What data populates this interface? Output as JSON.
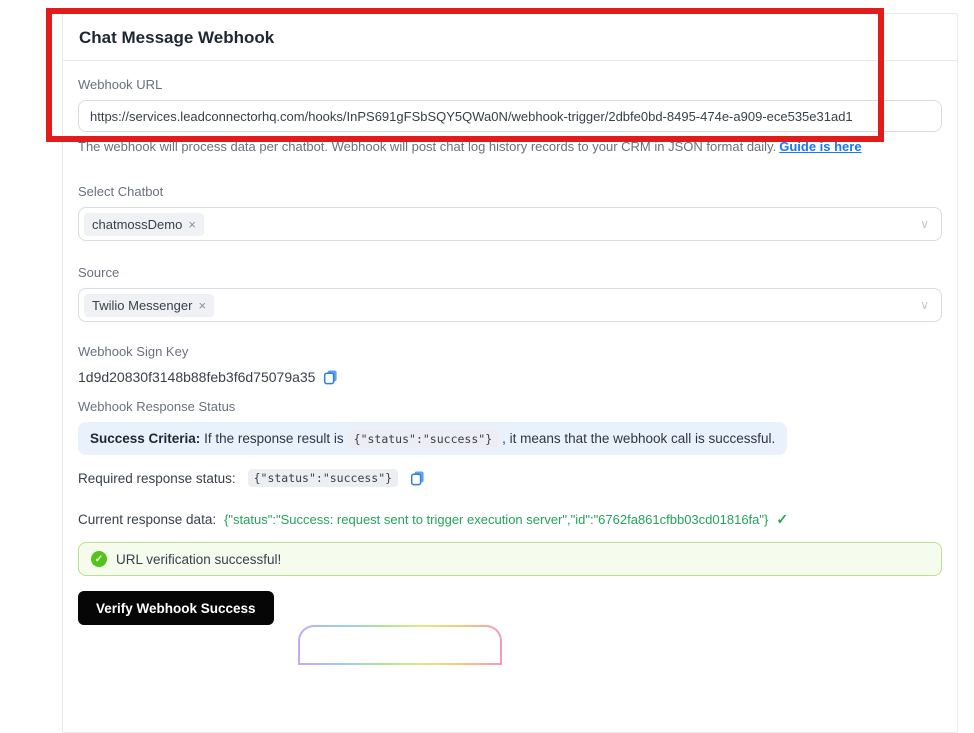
{
  "card": {
    "title": "Chat Message Webhook"
  },
  "webhook_url": {
    "label": "Webhook URL",
    "value": "https://services.leadconnectorhq.com/hooks/InPS691gFSbSQY5QWa0N/webhook-trigger/2dbfe0bd-8495-474e-a909-ece535e31ad1",
    "help_text": "The webhook will process data per chatbot. Webhook will post chat log history records to your CRM in JSON format daily.",
    "help_link": "Guide is here"
  },
  "select_chatbot": {
    "label": "Select Chatbot",
    "selected_tag": "chatmossDemo"
  },
  "source": {
    "label": "Source",
    "selected_tag": "Twilio Messenger"
  },
  "sign_key": {
    "label": "Webhook Sign Key",
    "value": "1d9d20830f3148b88feb3f6d75079a35"
  },
  "response_status": {
    "label": "Webhook Response Status",
    "criteria_bold": "Success Criteria:",
    "criteria_pre": " If the response result is",
    "criteria_code": "{\"status\":\"success\"}",
    "criteria_post": ", it means that the webhook call is successful."
  },
  "required_status": {
    "label": "Required response status:",
    "code": "{\"status\":\"success\"}"
  },
  "current_response": {
    "label": "Current response data:",
    "value": "{\"status\":\"Success: request sent to trigger execution server\",\"id\":\"6762fa861cfbb03cd01816fa\"}"
  },
  "alert": {
    "message": "URL verification successful!"
  },
  "verify_button": {
    "label": "Verify Webhook Success"
  },
  "icons": {
    "chevron_down": "∨",
    "remove": "×",
    "check": "✓"
  },
  "colors": {
    "annotation_red": "#e21b1b",
    "link_blue": "#1677ff",
    "copy_blue": "#2f7fe8",
    "success_green": "#23a45a",
    "alert_icon_green": "#52c41a",
    "alert_bg": "#f5fbed",
    "alert_border": "#b9e18e",
    "info_bg": "#e9f2fc",
    "button_bg": "#060606"
  }
}
